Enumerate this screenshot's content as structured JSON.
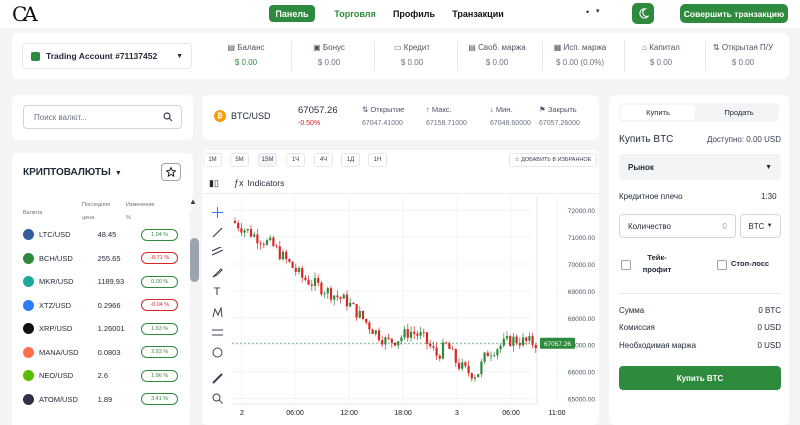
{
  "nav": {
    "logo_text": "CA",
    "panel": "Панель",
    "trading": "Торговля",
    "profile": "Профиль",
    "transactions": "Транзакции",
    "dots": "•",
    "chevron": "▾",
    "cta": "Совершить транзакцию"
  },
  "account": {
    "name": "Trading Account #71137452",
    "stats": [
      {
        "label": "Баланс",
        "value": "$ 0.00",
        "icon": "wallet-icon"
      },
      {
        "label": "Бонус",
        "value": "$ 0.00",
        "icon": "gift-icon"
      },
      {
        "label": "Кредит",
        "value": "$ 0.00",
        "icon": "credit-card-icon"
      },
      {
        "label": "Своб. маржа",
        "value": "$ 0.00",
        "icon": "document-icon"
      },
      {
        "label": "Исп. маржа",
        "value": "$ 0.00 (0.0%)",
        "icon": "picture-icon"
      },
      {
        "label": "Капитал",
        "value": "$ 0.00",
        "icon": "bank-icon"
      },
      {
        "label": "Открытая П/У",
        "value": "$ 0.00",
        "icon": "arrows-icon"
      }
    ]
  },
  "search": {
    "placeholder": "Поиск валют..."
  },
  "crypto_list": {
    "title": "КРИПТОВАЛЮТЫ",
    "headers": {
      "currency": "Валюта",
      "last_price_1": "Последняя",
      "last_price_2": "цена",
      "change_1": "Изменение",
      "change_2": "%"
    },
    "rows": [
      {
        "symbol": "LTC/USD",
        "price": "48.45",
        "change": "1.04 %",
        "dir": "up",
        "color": "#345d9d"
      },
      {
        "symbol": "BCH/USD",
        "price": "255.65",
        "change": "-8.71 %",
        "dir": "dn",
        "color": "#2e8b3e"
      },
      {
        "symbol": "MKR/USD",
        "price": "1189.93",
        "change": "0.00 %",
        "dir": "up",
        "color": "#1aab9b"
      },
      {
        "symbol": "XTZ/USD",
        "price": "0.2966",
        "change": "-0.04 %",
        "dir": "dn",
        "color": "#2c7df7"
      },
      {
        "symbol": "XRP/USD",
        "price": "1.26001",
        "change": "1.63 %",
        "dir": "up",
        "color": "#111111"
      },
      {
        "symbol": "MANA/USD",
        "price": "0.0803",
        "change": "2.93 %",
        "dir": "up",
        "color": "#ff6f4a"
      },
      {
        "symbol": "NEO/USD",
        "price": "2.6",
        "change": "1.96 %",
        "dir": "up",
        "color": "#58bf00"
      },
      {
        "symbol": "ATOM/USD",
        "price": "1.89",
        "change": "3.41 %",
        "dir": "up",
        "color": "#2e3148"
      }
    ]
  },
  "ticker": {
    "coin_glyph": "₿",
    "pair": "BTC/USD",
    "last": "67057.26",
    "change": "-0.50%",
    "open_label": "Открытие",
    "open": "67047.41000",
    "high_label": "Макс.",
    "high": "67158.71000",
    "low_label": "Мин.",
    "low": "67048.60000",
    "close_label": "Закрыть",
    "close": "67057.26000"
  },
  "chart": {
    "timeframes": [
      "1M",
      "5M",
      "15M",
      "1Ч",
      "4Ч",
      "1Д",
      "1Н"
    ],
    "active_timeframe": "15M",
    "add_favorite": "ДОБАВИТЬ В ИЗБРАННОЕ",
    "indicators": "Indicators",
    "y_ticks": [
      "72000.00",
      "71000.00",
      "70000.00",
      "69000.00",
      "68000.00",
      "67000.00",
      "66000.00",
      "65000.00"
    ],
    "x_ticks": [
      "2",
      "06:00",
      "12:00",
      "18:00",
      "3",
      "06:00",
      "11:00"
    ],
    "current_price_label": "67057.26",
    "current_price": 67057.26,
    "ylim": [
      64800,
      72300
    ],
    "series_hint": "descending from ~71600 to ~67000 with low ~65600"
  },
  "order": {
    "tab_buy": "Купить",
    "tab_sell": "Продать",
    "title": "Купить BTC",
    "available": "Доступно: 0.00 USD",
    "order_type": "Рынок",
    "leverage_label": "Кредитное плечо",
    "leverage_value": "1:30",
    "quantity_label": "Количество",
    "quantity_value": "0",
    "quantity_currency": "BTC",
    "take_profit_1": "Тейк-",
    "take_profit_2": "профит",
    "stop_loss": "Стоп-лосс",
    "summary": [
      {
        "label": "Сумма",
        "value": "0 BTC"
      },
      {
        "label": "Комиссия",
        "value": "0 USD"
      },
      {
        "label": "Необходимая маржа",
        "value": "0 USD"
      }
    ],
    "submit": "Купить BTC"
  },
  "colors": {
    "accent": "#2e8b3e",
    "up": "#2e8b3e",
    "down": "#dc2626"
  }
}
